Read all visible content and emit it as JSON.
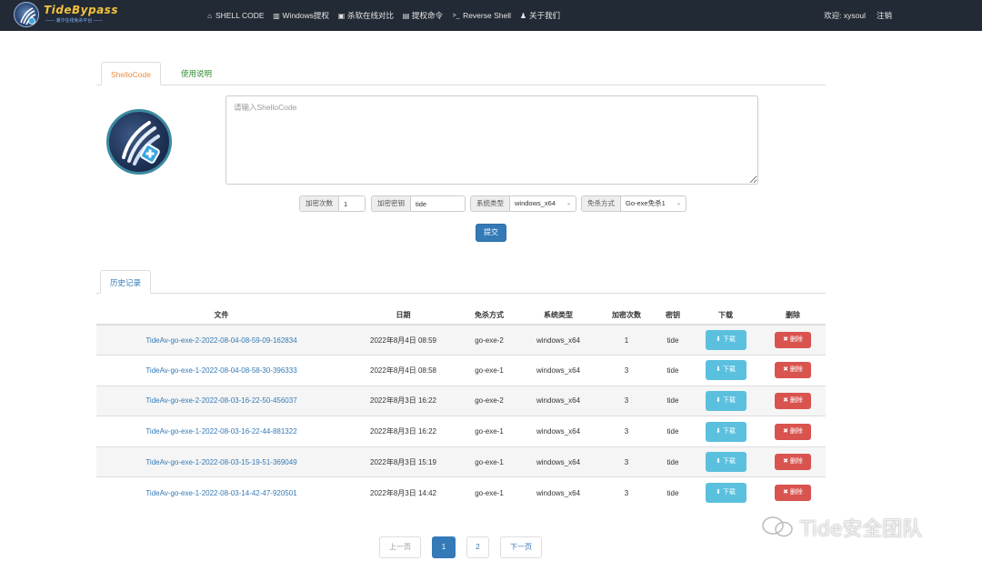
{
  "brand": {
    "title": "TideBypass",
    "subtitle": "—— 潮汐在线免杀平台 ——"
  },
  "nav": {
    "items": [
      {
        "icon": "home-icon",
        "glyph": "⌂",
        "label": "SHELL CODE"
      },
      {
        "icon": "trash-icon",
        "glyph": "▥",
        "label": "Windows提权"
      },
      {
        "icon": "compare-icon",
        "glyph": "▣",
        "label": "杀软在线对比"
      },
      {
        "icon": "save-icon",
        "glyph": "▤",
        "label": "提权命令"
      },
      {
        "icon": "terminal-icon",
        "glyph": ">_",
        "label": "Reverse Shell"
      },
      {
        "icon": "user-icon",
        "glyph": "♟",
        "label": "关于我们"
      }
    ],
    "welcome": "欢迎: xysoul",
    "logout": "注销"
  },
  "tabs": {
    "shellcode": "ShelloCode",
    "usage": "使用说明"
  },
  "shellcode_input": {
    "placeholder": "请输入ShelloCode",
    "value": ""
  },
  "form": {
    "encrypt_times_label": "加密次数",
    "encrypt_times_value": "1",
    "encrypt_key_label": "加密密钥",
    "encrypt_key_value": "tide",
    "os_label": "系统类型",
    "os_value": "windows_x64",
    "mode_label": "免杀方式",
    "mode_value": "Go-exe免杀1",
    "submit": "提交"
  },
  "history": {
    "tab": "历史记录",
    "headers": {
      "file": "文件",
      "date": "日期",
      "mode": "免杀方式",
      "os": "系统类型",
      "times": "加密次数",
      "key": "密钥",
      "download": "下载",
      "delete": "删除"
    },
    "download_label": "⬇ 下载",
    "delete_label": "✖ 删除",
    "rows": [
      {
        "file": "TideAv-go-exe-2-2022-08-04-08-59-09-162834",
        "date": "2022年8月4日 08:59",
        "mode": "go-exe-2",
        "os": "windows_x64",
        "times": "1",
        "key": "tide"
      },
      {
        "file": "TideAv-go-exe-1-2022-08-04-08-58-30-396333",
        "date": "2022年8月4日 08:58",
        "mode": "go-exe-1",
        "os": "windows_x64",
        "times": "3",
        "key": "tide"
      },
      {
        "file": "TideAv-go-exe-2-2022-08-03-16-22-50-456037",
        "date": "2022年8月3日 16:22",
        "mode": "go-exe-2",
        "os": "windows_x64",
        "times": "3",
        "key": "tide"
      },
      {
        "file": "TideAv-go-exe-1-2022-08-03-16-22-44-881322",
        "date": "2022年8月3日 16:22",
        "mode": "go-exe-1",
        "os": "windows_x64",
        "times": "3",
        "key": "tide"
      },
      {
        "file": "TideAv-go-exe-1-2022-08-03-15-19-51-369049",
        "date": "2022年8月3日 15:19",
        "mode": "go-exe-1",
        "os": "windows_x64",
        "times": "3",
        "key": "tide"
      },
      {
        "file": "TideAv-go-exe-1-2022-08-03-14-42-47-920501",
        "date": "2022年8月3日 14:42",
        "mode": "go-exe-1",
        "os": "windows_x64",
        "times": "3",
        "key": "tide"
      }
    ]
  },
  "pagination": {
    "prev": "上一页",
    "pages": [
      "1",
      "2"
    ],
    "current": "1",
    "next": "下一页"
  },
  "watermark": "Tide安全团队",
  "colors": {
    "navbar": "#222a35",
    "primary": "#337ab7",
    "info": "#5bc0de",
    "danger": "#d9534f",
    "brand_gold": "#f2c23a"
  }
}
